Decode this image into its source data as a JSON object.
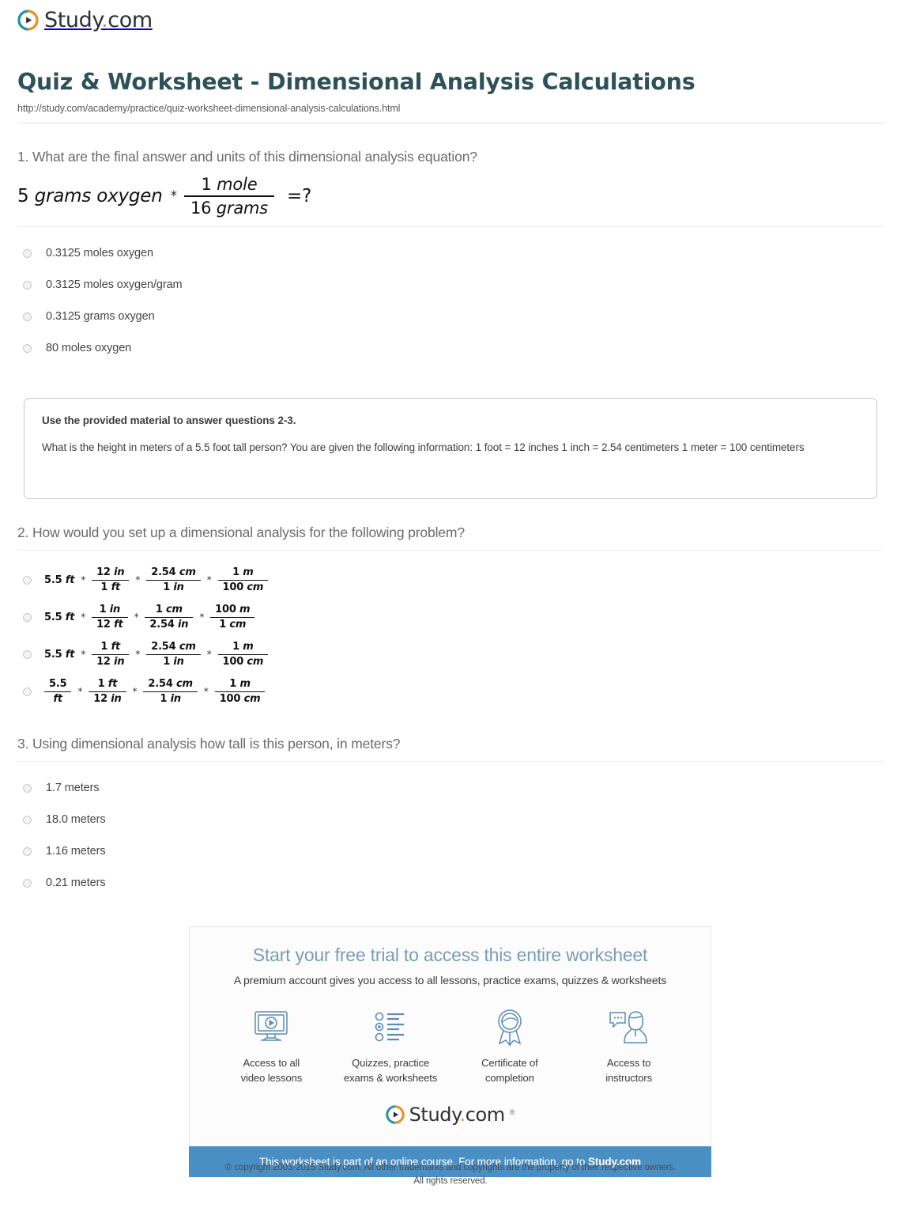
{
  "brand": {
    "name": "Study",
    "suffix": ".com",
    "logo_icon": "play-circle-icon",
    "accent_orange": "#e8921f",
    "accent_teal": "#2d8fa3",
    "bar_blue": "#4a8fc4"
  },
  "header": {
    "title": "Quiz & Worksheet - Dimensional Analysis Calculations",
    "url": "http://study.com/academy/practice/quiz-worksheet-dimensional-analysis-calculations.html",
    "title_color": "#2d5159"
  },
  "questions": [
    {
      "number": "1.",
      "prompt": "What are the final answer and units of this dimensional analysis equation?",
      "equation": {
        "lead_number": "5",
        "lead_units": "grams oxygen",
        "operator": "*",
        "numerator_number": "1",
        "numerator_units": "mole",
        "denominator_number": "16",
        "denominator_units": "grams",
        "tail": "=?"
      },
      "options": [
        "0.3125 moles oxygen",
        "0.3125 moles oxygen/gram",
        "0.3125 grams oxygen",
        "80 moles oxygen"
      ]
    },
    {
      "number": "2.",
      "prompt": "How would you set up a dimensional analysis for the following problem?",
      "math_options": [
        {
          "lead": {
            "number": "5.5",
            "units": "ft"
          },
          "factors": [
            {
              "num_number": "12",
              "num_units": "in",
              "den_number": "1",
              "den_units": "ft"
            },
            {
              "num_number": "2.54",
              "num_units": "cm",
              "den_number": "1",
              "den_units": "in"
            },
            {
              "num_number": "1",
              "num_units": "m",
              "den_number": "100",
              "den_units": "cm"
            }
          ]
        },
        {
          "lead": {
            "number": "5.5",
            "units": "ft"
          },
          "factors": [
            {
              "num_number": "1",
              "num_units": "in",
              "den_number": "12",
              "den_units": "ft"
            },
            {
              "num_number": "1",
              "num_units": "cm",
              "den_number": "2.54",
              "den_units": "in"
            },
            {
              "num_number": "100",
              "num_units": "m",
              "den_number": "1",
              "den_units": "cm"
            }
          ]
        },
        {
          "lead": {
            "number": "5.5",
            "units": "ft"
          },
          "factors": [
            {
              "num_number": "1",
              "num_units": "ft",
              "den_number": "12",
              "den_units": "in"
            },
            {
              "num_number": "2.54",
              "num_units": "cm",
              "den_number": "1",
              "den_units": "in"
            },
            {
              "num_number": "1",
              "num_units": "m",
              "den_number": "100",
              "den_units": "cm"
            }
          ]
        },
        {
          "lead_fraction": {
            "num_number": "5.5",
            "num_units": "",
            "den_number": "",
            "den_units": "ft"
          },
          "factors": [
            {
              "num_number": "1",
              "num_units": "ft",
              "den_number": "12",
              "den_units": "in"
            },
            {
              "num_number": "2.54",
              "num_units": "cm",
              "den_number": "1",
              "den_units": "in"
            },
            {
              "num_number": "1",
              "num_units": "m",
              "den_number": "100",
              "den_units": "cm"
            }
          ]
        }
      ]
    },
    {
      "number": "3.",
      "prompt": "Using dimensional analysis how tall is this person, in meters?",
      "options": [
        "1.7 meters",
        "18.0 meters",
        "1.16 meters",
        "0.21 meters"
      ]
    }
  ],
  "infobox": {
    "title": "Use the provided material to answer questions 2-3.",
    "body": "What is the height in meters of a 5.5 foot tall person? You are given the following information: 1 foot = 12 inches 1 inch = 2.54 centimeters 1 meter = 100 centimeters"
  },
  "promo": {
    "headline": "Start your free trial to access this entire worksheet",
    "subhead": "A premium account gives you access to all lessons, practice exams, quizzes & worksheets",
    "features": [
      {
        "icon": "monitor-play-icon",
        "label_line1": "Access to all",
        "label_line2": "video lessons"
      },
      {
        "icon": "checklist-icon",
        "label_line1": "Quizzes, practice",
        "label_line2": "exams & worksheets"
      },
      {
        "icon": "certificate-ribbon-icon",
        "label_line1": "Certificate of",
        "label_line2": "completion"
      },
      {
        "icon": "instructor-chat-icon",
        "label_line1": "Access to",
        "label_line2": "instructors"
      }
    ],
    "logo_tm": "®",
    "bar_text_prefix": "This worksheet is part of an online course. For more information, go to ",
    "bar_link": "Study.com"
  },
  "copyright": {
    "line1": "© copyright 2003-2015 Study.com. All other trademarks and copyrights are the property of their respective owners.",
    "line2": "All rights reserved."
  }
}
